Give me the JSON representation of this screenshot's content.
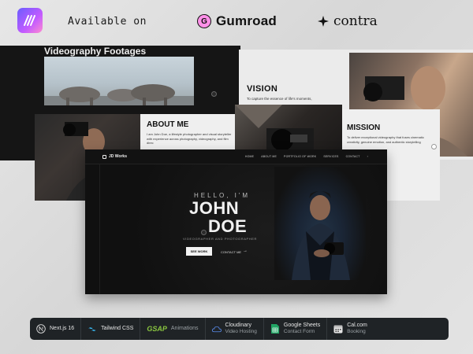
{
  "header": {
    "available_label": "Available on",
    "gumroad_label": "Gumroad",
    "contra_label": "contra"
  },
  "colors": {
    "logo_gradient": [
      "#6a5cff",
      "#c35bff",
      "#ff8bd1"
    ],
    "gumroad_pink": "#ff90e8",
    "stack_bar_bg": "#1f2326",
    "gsap_green": "#8ac640"
  },
  "preview": {
    "footage_title": "Videography Footages",
    "mini_logo": "JD Works",
    "vision": {
      "title": "VISION",
      "text": "To capture the essence of life's moments,"
    },
    "about": {
      "title": "ABOUT ME",
      "text": "I am John Doe, a lifestyle photographer and visual storyteller with experience across photography, videography, and film direc"
    },
    "mission": {
      "title": "MISSION",
      "text": "To deliver exceptional videography that fuses cinematic creativity, genuine emotion, and authentic storytelling"
    },
    "hero": {
      "logo": "JD Works",
      "menu": [
        "HOME",
        "ABOUT ME",
        "PORTFOLIO OF WORK",
        "SERVICES",
        "CONTACT"
      ],
      "hello": "HELLO, I'M",
      "first_name": "JOHN",
      "last_name": "DOE",
      "role": "VIDEOGRAPHER AND PHOTOGRAPHER",
      "primary_cta": "SEE WORK",
      "secondary_cta": "CONTACT ME"
    }
  },
  "stack": [
    {
      "label": "Next.js 16",
      "sub": "",
      "icon": "nextjs-icon"
    },
    {
      "label": "Tailwind CSS",
      "sub": "",
      "icon": "tailwind-icon"
    },
    {
      "label": "Animations",
      "sub": "",
      "icon": "gsap-icon",
      "brand": "GSAP"
    },
    {
      "label": "Cloudinary",
      "sub": "Video Hosting",
      "icon": "cloudinary-icon"
    },
    {
      "label": "Google Sheets",
      "sub": "Contact Form",
      "icon": "google-sheets-icon"
    },
    {
      "label": "Cal.com",
      "sub": "Booking",
      "icon": "calendar-icon"
    }
  ]
}
